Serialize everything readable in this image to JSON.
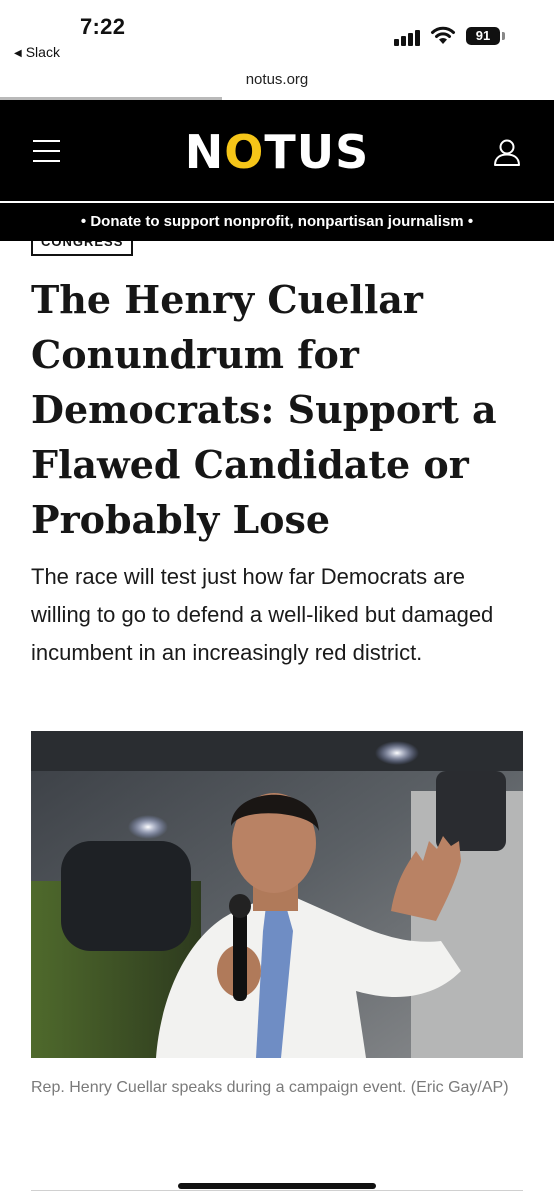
{
  "status_bar": {
    "time": "7:22",
    "back_app": "Slack",
    "battery": "91"
  },
  "browser": {
    "url": "notus.org",
    "load_progress": 0.4
  },
  "header": {
    "logo_text": [
      "N",
      "O",
      "TUS"
    ],
    "menu_icon": "hamburger-menu-icon",
    "account_icon": "user-account-icon"
  },
  "donate_banner": {
    "text": "• Donate to support nonprofit, nonpartisan journalism •"
  },
  "article": {
    "category": "CONGRESS",
    "headline": "The Henry Cuellar Conundrum for Democrats: Support a Flawed Candidate or Probably Lose",
    "dek": "The race will test just how far Democrats are willing to go to defend a well-liked but damaged incumbent in an increasingly red district.",
    "photo_caption": "Rep. Henry Cuellar speaks during a campaign event. (Eric Gay/AP)"
  },
  "colors": {
    "brand_yellow": "#f5c518",
    "header_bg": "#000000"
  }
}
